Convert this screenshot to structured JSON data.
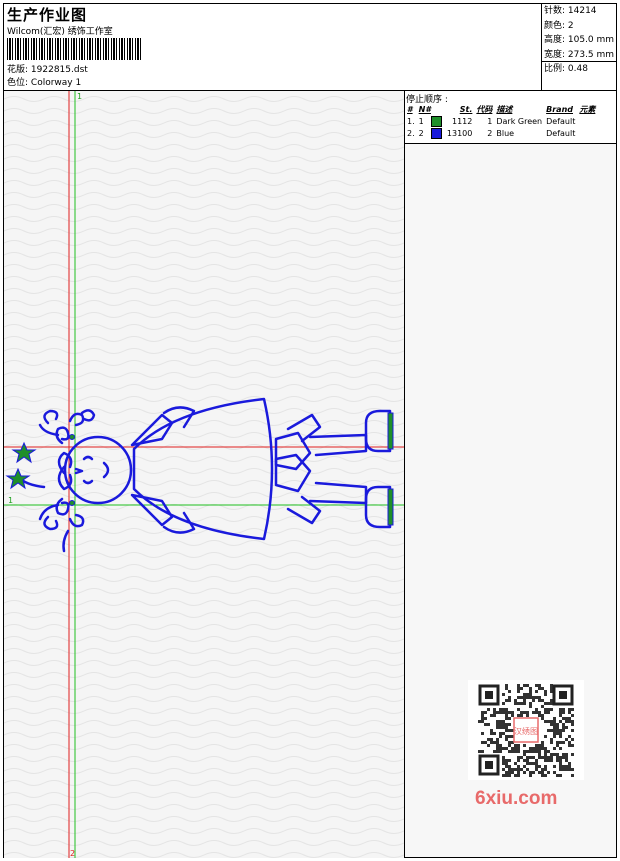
{
  "header": {
    "title": "生产作业图",
    "company": "Wilcom(汇宏) 绣饰工作室",
    "file_label": "花版:",
    "file_value": "1922815.dst",
    "colorway_label": "色位:",
    "colorway_value": "Colorway 1"
  },
  "stats": {
    "stitches": "针数: 14214",
    "colors": "颜色: 2",
    "height": "高度: 105.0 mm",
    "width": "宽度: 273.5 mm",
    "scale": "比例: 0.48"
  },
  "design": {
    "v1_label": "1",
    "v2_label": "2",
    "h1_label": "1",
    "thread_blue": "#1a1adc",
    "thread_green": "#1f8f2a",
    "guide_red": "#e02020",
    "guide_green": "#20c020"
  },
  "stop_sequence": {
    "title": "停止顺序 :",
    "headers": [
      "#",
      "N#",
      "St.",
      "代码",
      "描述",
      "Brand",
      "元素"
    ],
    "rows": [
      {
        "idx": "1.",
        "n": "1",
        "color": "#1f8f2a",
        "st": "1112",
        "code": "1",
        "desc": "Dark Green",
        "brand": "Default",
        "elem": ""
      },
      {
        "idx": "2.",
        "n": "2",
        "color": "#1a1adc",
        "st": "13100",
        "code": "2",
        "desc": "Blue",
        "brand": "Default",
        "elem": ""
      }
    ]
  },
  "watermark": {
    "qr_badge": "汉绣图",
    "site": "6xiu.com"
  }
}
